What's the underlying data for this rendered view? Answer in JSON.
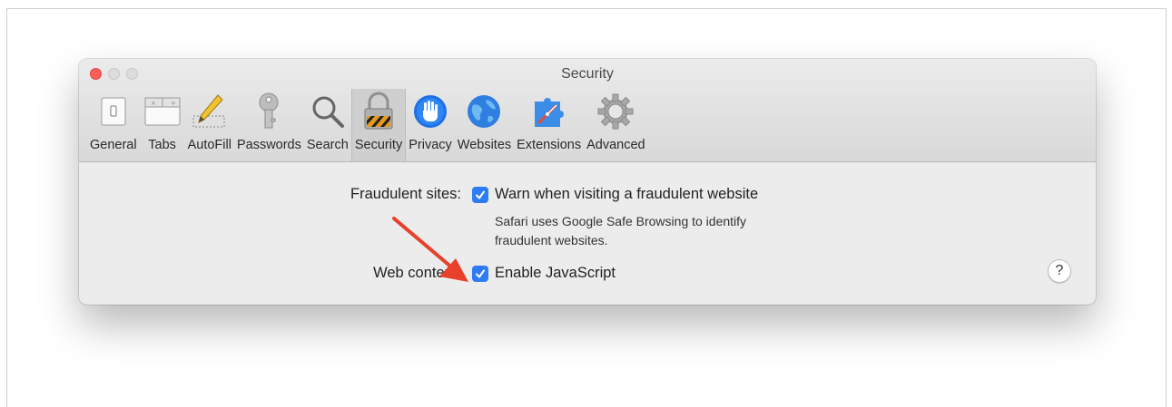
{
  "window": {
    "title": "Security"
  },
  "toolbar": {
    "items": [
      {
        "label": "General",
        "icon": "general-icon"
      },
      {
        "label": "Tabs",
        "icon": "tabs-icon"
      },
      {
        "label": "AutoFill",
        "icon": "autofill-pencil-icon"
      },
      {
        "label": "Passwords",
        "icon": "key-icon"
      },
      {
        "label": "Search",
        "icon": "magnifier-icon"
      },
      {
        "label": "Security",
        "icon": "padlock-icon",
        "active": true
      },
      {
        "label": "Privacy",
        "icon": "hand-icon"
      },
      {
        "label": "Websites",
        "icon": "globe-icon"
      },
      {
        "label": "Extensions",
        "icon": "puzzle-icon"
      },
      {
        "label": "Advanced",
        "icon": "gear-icon"
      }
    ]
  },
  "security": {
    "fraudulent_label": "Fraudulent sites:",
    "fraudulent_option": "Warn when visiting a fraudulent website",
    "fraudulent_checked": true,
    "fraudulent_desc_line1": "Safari uses Google Safe Browsing to identify",
    "fraudulent_desc_line2": "fraudulent websites.",
    "web_content_label": "Web content:",
    "javascript_option": "Enable JavaScript",
    "javascript_checked": true,
    "help": "?"
  },
  "colors": {
    "accent": "#2d7cf6",
    "arrow": "#e8402a",
    "close": "#fe5f57"
  }
}
